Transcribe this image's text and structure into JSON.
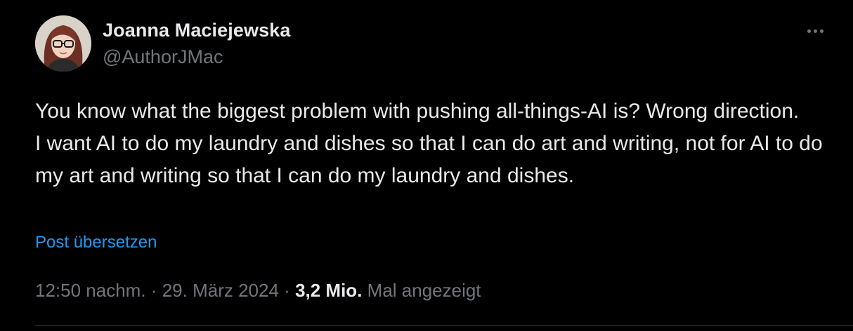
{
  "author": {
    "display_name": "Joanna Maciejewska",
    "handle": "@AuthorJMac"
  },
  "post": {
    "line1": "You know what the biggest problem with pushing all-things-AI is? Wrong direction.",
    "line2": "I want AI to do my laundry and dishes so that I can do art and writing, not for AI to do my art and writing so that I can do my laundry and dishes."
  },
  "translate_label": "Post übersetzen",
  "meta": {
    "time": "12:50 nachm.",
    "separator": "·",
    "date": "29. März 2024",
    "views_count": "3,2 Mio.",
    "views_label": "Mal angezeigt"
  },
  "icons": {
    "more": "more-horizontal-icon",
    "avatar": "profile-photo"
  },
  "colors": {
    "background": "#000000",
    "text_primary": "#e7e9ea",
    "text_secondary": "#71767b",
    "link": "#1d9bf0",
    "divider": "#2f3336"
  }
}
